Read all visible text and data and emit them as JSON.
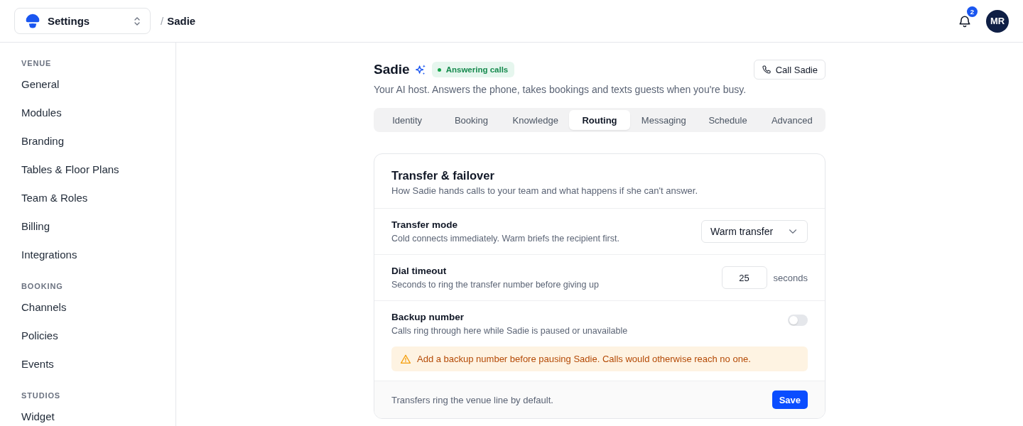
{
  "header": {
    "workspace_switcher": {
      "label": "Settings"
    },
    "breadcrumb": {
      "separator": "/",
      "current": "Sadie"
    },
    "notifications": {
      "count": "2"
    },
    "avatar": {
      "initials": "MR"
    }
  },
  "sidebar": {
    "sections": [
      {
        "heading": "VENUE",
        "items": [
          {
            "label": "General",
            "selected": false
          },
          {
            "label": "Modules",
            "selected": false
          },
          {
            "label": "Branding",
            "selected": false
          },
          {
            "label": "Tables & Floor Plans",
            "selected": false
          },
          {
            "label": "Team & Roles",
            "selected": false
          },
          {
            "label": "Billing",
            "selected": false
          },
          {
            "label": "Integrations",
            "selected": false
          }
        ]
      },
      {
        "heading": "BOOKING",
        "items": [
          {
            "label": "Channels",
            "selected": false
          },
          {
            "label": "Policies",
            "selected": false
          },
          {
            "label": "Events",
            "selected": false
          }
        ]
      },
      {
        "heading": "STUDIOS",
        "items": [
          {
            "label": "Widget",
            "selected": false
          }
        ]
      }
    ]
  },
  "page": {
    "title": "Sadie",
    "status_badge": {
      "label": "Answering calls"
    },
    "call_button": {
      "label": "Call Sadie"
    },
    "subtitle": "Your AI host. Answers the phone, takes bookings and texts guests when you're busy.",
    "tabs": [
      {
        "label": "Identity",
        "selected": false
      },
      {
        "label": "Booking",
        "selected": false
      },
      {
        "label": "Knowledge",
        "selected": false
      },
      {
        "label": "Routing",
        "selected": true
      },
      {
        "label": "Messaging",
        "selected": false
      },
      {
        "label": "Schedule",
        "selected": false
      },
      {
        "label": "Advanced",
        "selected": false
      }
    ]
  },
  "card": {
    "title": "Transfer & failover",
    "description": "How Sadie hands calls to your team and what happens if she can't answer.",
    "settings": [
      {
        "kind": "select",
        "label": "Transfer mode",
        "description": "Cold connects immediately. Warm briefs the recipient first.",
        "value": "Warm transfer"
      },
      {
        "kind": "number",
        "label": "Dial timeout",
        "description": "Seconds to ring the transfer number before giving up",
        "value": "25",
        "unit": "seconds"
      },
      {
        "kind": "toggle",
        "label": "Backup number",
        "description": "Calls ring through here while Sadie is paused or unavailable",
        "on": false,
        "warning": "Add a backup number before pausing Sadie. Calls would otherwise reach no one."
      }
    ],
    "footer": {
      "note": "Transfers ring the venue line by default.",
      "save_button": "Save"
    }
  }
}
